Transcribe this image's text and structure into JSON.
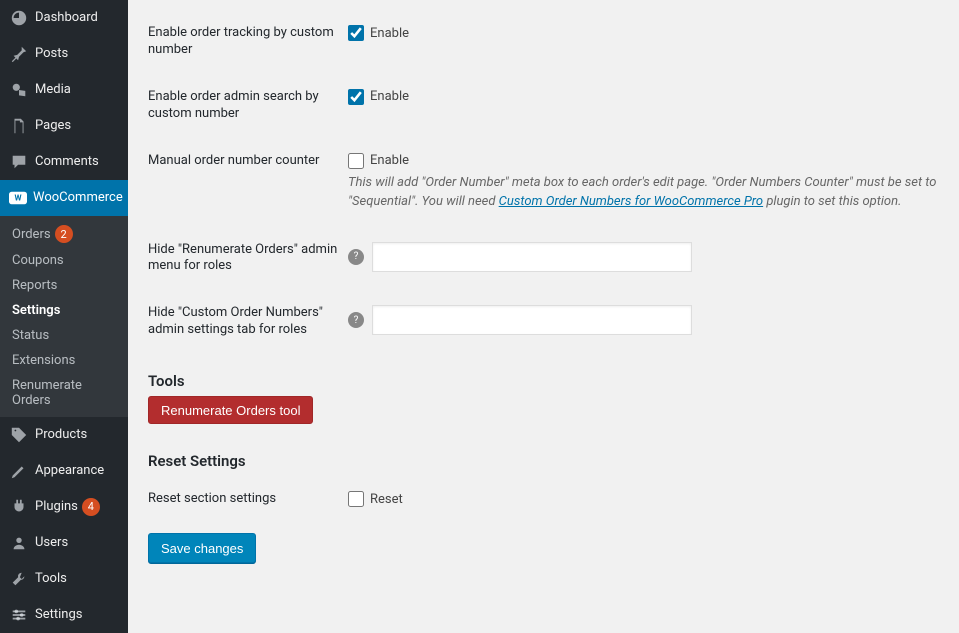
{
  "sidebar": {
    "items": [
      {
        "label": "Dashboard"
      },
      {
        "label": "Posts"
      },
      {
        "label": "Media"
      },
      {
        "label": "Pages"
      },
      {
        "label": "Comments"
      },
      {
        "label": "WooCommerce"
      },
      {
        "label": "Products"
      },
      {
        "label": "Appearance"
      },
      {
        "label": "Plugins",
        "badge": "4"
      },
      {
        "label": "Users"
      },
      {
        "label": "Tools"
      },
      {
        "label": "Settings"
      }
    ],
    "submenu": {
      "orders_label": "Orders",
      "orders_badge": "2",
      "coupons_label": "Coupons",
      "reports_label": "Reports",
      "settings_label": "Settings",
      "status_label": "Status",
      "extensions_label": "Extensions",
      "renumerate_label": "Renumerate Orders"
    }
  },
  "form": {
    "enable_tracking_label": "Enable order tracking by custom number",
    "enable_tracking_value": "Enable",
    "enable_search_label": "Enable order admin search by custom number",
    "enable_search_value": "Enable",
    "manual_counter_label": "Manual order number counter",
    "manual_counter_value": "Enable",
    "manual_counter_desc_1": "This will add \"Order Number\" meta box to each order's edit page. \"Order Numbers Counter\" must be set to \"Sequential\". You will need ",
    "manual_counter_link": "Custom Order Numbers for WooCommerce Pro",
    "manual_counter_desc_2": " plugin to set this option.",
    "hide_menu_label": "Hide \"Renumerate Orders\" admin menu for roles",
    "hide_tab_label": "Hide \"Custom Order Numbers\" admin settings tab for roles",
    "tools_heading": "Tools",
    "renumerate_btn": "Renumerate Orders tool",
    "reset_heading": "Reset Settings",
    "reset_label": "Reset section settings",
    "reset_value": "Reset",
    "save_btn": "Save changes"
  }
}
